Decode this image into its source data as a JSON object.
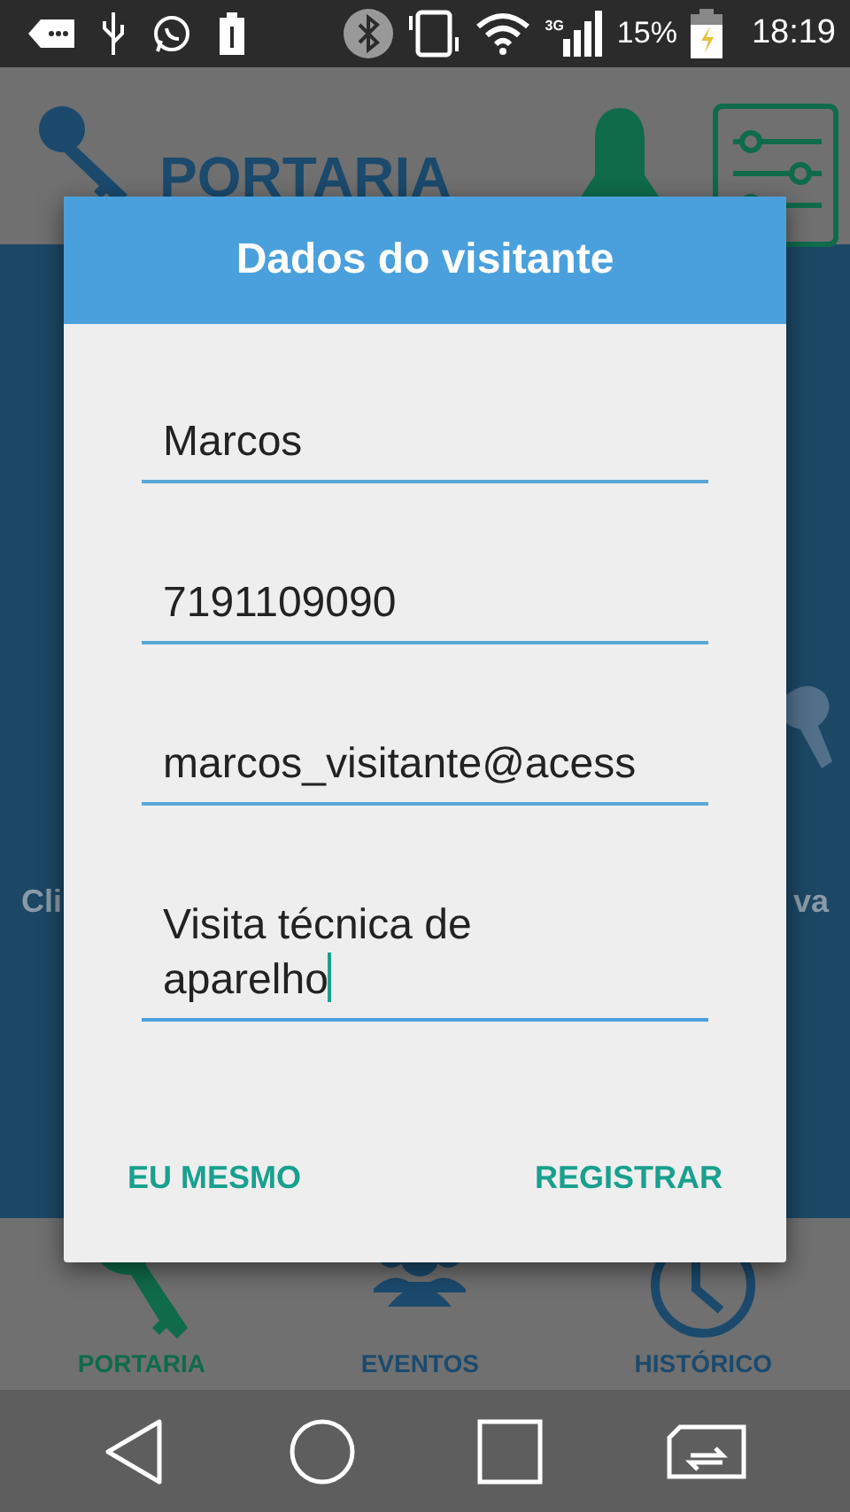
{
  "status_bar": {
    "network": "3G",
    "battery": "15%",
    "time": "18:19"
  },
  "header": {
    "title": "PORTARIA"
  },
  "background_labels": [
    "Cli",
    "va"
  ],
  "dialog": {
    "title": "Dados do visitante",
    "fields": [
      {
        "value": "Marcos",
        "focused": false
      },
      {
        "value": "7191109090",
        "focused": false
      },
      {
        "value": "marcos_visitante@acess",
        "focused": false
      },
      {
        "value": "Visita técnica de aparelho",
        "focused": true
      }
    ],
    "buttons": [
      "EU MESMO",
      "REGISTRAR"
    ]
  },
  "bottom_nav": [
    {
      "label": "PORTARIA",
      "selected": true
    },
    {
      "label": "EVENTOS",
      "selected": false
    },
    {
      "label": "HISTÓRICO",
      "selected": false
    }
  ]
}
